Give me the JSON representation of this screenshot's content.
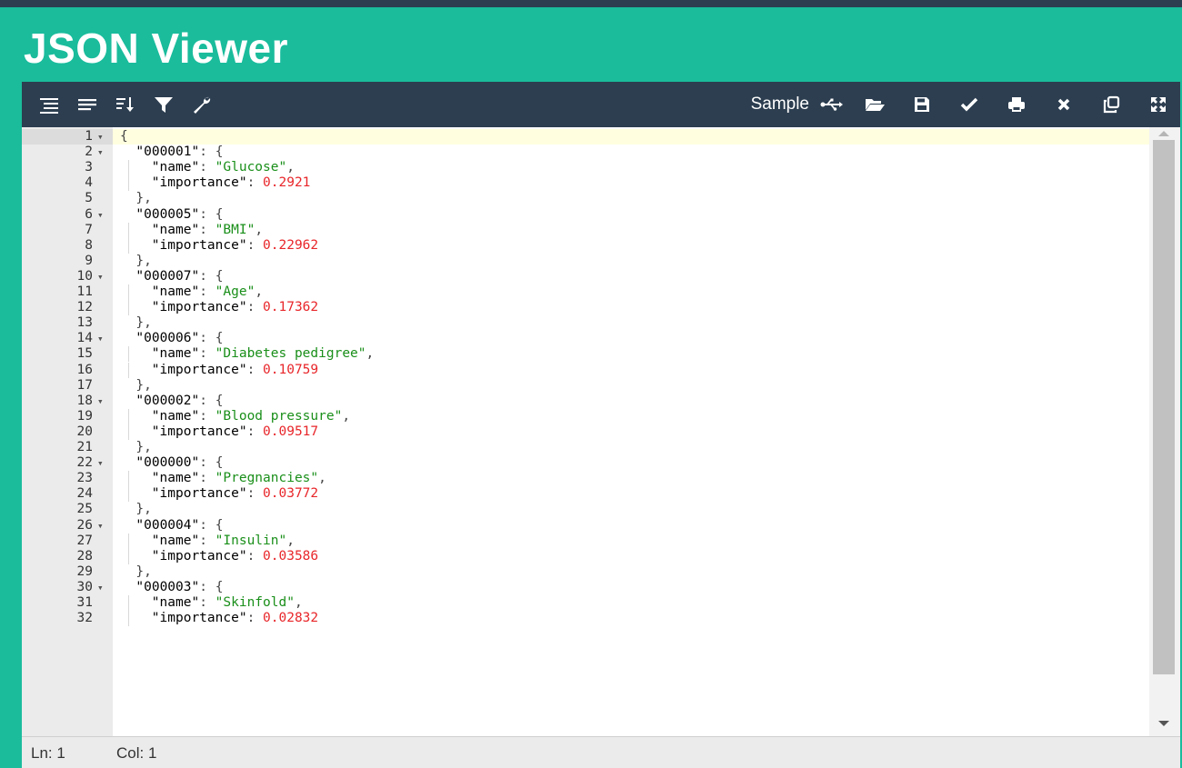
{
  "app": {
    "title": "JSON Viewer"
  },
  "toolbar": {
    "left_icons": [
      "format-icon",
      "compact-icon",
      "sort-icon",
      "filter-icon",
      "wrench-icon"
    ],
    "sample_label": "Sample",
    "right_icons": [
      "usb-icon",
      "open-folder-icon",
      "save-icon",
      "check-icon",
      "print-icon",
      "close-icon",
      "copy-icon",
      "expand-icon"
    ]
  },
  "editor": {
    "lines": [
      {
        "n": "1",
        "fold": true,
        "indent": 0,
        "tokens": [
          [
            "p",
            "{"
          ]
        ]
      },
      {
        "n": "2",
        "fold": true,
        "indent": 1,
        "tokens": [
          [
            "k",
            "\"000001\""
          ],
          [
            "p",
            ": {"
          ]
        ]
      },
      {
        "n": "3",
        "fold": false,
        "indent": 2,
        "tokens": [
          [
            "k",
            "\"name\""
          ],
          [
            "p",
            ": "
          ],
          [
            "s",
            "\"Glucose\""
          ],
          [
            "p",
            ","
          ]
        ]
      },
      {
        "n": "4",
        "fold": false,
        "indent": 2,
        "tokens": [
          [
            "k",
            "\"importance\""
          ],
          [
            "p",
            ": "
          ],
          [
            "n",
            "0.2921"
          ]
        ]
      },
      {
        "n": "5",
        "fold": false,
        "indent": 1,
        "tokens": [
          [
            "p",
            "},"
          ]
        ]
      },
      {
        "n": "6",
        "fold": true,
        "indent": 1,
        "tokens": [
          [
            "k",
            "\"000005\""
          ],
          [
            "p",
            ": {"
          ]
        ]
      },
      {
        "n": "7",
        "fold": false,
        "indent": 2,
        "tokens": [
          [
            "k",
            "\"name\""
          ],
          [
            "p",
            ": "
          ],
          [
            "s",
            "\"BMI\""
          ],
          [
            "p",
            ","
          ]
        ]
      },
      {
        "n": "8",
        "fold": false,
        "indent": 2,
        "tokens": [
          [
            "k",
            "\"importance\""
          ],
          [
            "p",
            ": "
          ],
          [
            "n",
            "0.22962"
          ]
        ]
      },
      {
        "n": "9",
        "fold": false,
        "indent": 1,
        "tokens": [
          [
            "p",
            "},"
          ]
        ]
      },
      {
        "n": "10",
        "fold": true,
        "indent": 1,
        "tokens": [
          [
            "k",
            "\"000007\""
          ],
          [
            "p",
            ": {"
          ]
        ]
      },
      {
        "n": "11",
        "fold": false,
        "indent": 2,
        "tokens": [
          [
            "k",
            "\"name\""
          ],
          [
            "p",
            ": "
          ],
          [
            "s",
            "\"Age\""
          ],
          [
            "p",
            ","
          ]
        ]
      },
      {
        "n": "12",
        "fold": false,
        "indent": 2,
        "tokens": [
          [
            "k",
            "\"importance\""
          ],
          [
            "p",
            ": "
          ],
          [
            "n",
            "0.17362"
          ]
        ]
      },
      {
        "n": "13",
        "fold": false,
        "indent": 1,
        "tokens": [
          [
            "p",
            "},"
          ]
        ]
      },
      {
        "n": "14",
        "fold": true,
        "indent": 1,
        "tokens": [
          [
            "k",
            "\"000006\""
          ],
          [
            "p",
            ": {"
          ]
        ]
      },
      {
        "n": "15",
        "fold": false,
        "indent": 2,
        "tokens": [
          [
            "k",
            "\"name\""
          ],
          [
            "p",
            ": "
          ],
          [
            "s",
            "\"Diabetes pedigree\""
          ],
          [
            "p",
            ","
          ]
        ]
      },
      {
        "n": "16",
        "fold": false,
        "indent": 2,
        "tokens": [
          [
            "k",
            "\"importance\""
          ],
          [
            "p",
            ": "
          ],
          [
            "n",
            "0.10759"
          ]
        ]
      },
      {
        "n": "17",
        "fold": false,
        "indent": 1,
        "tokens": [
          [
            "p",
            "},"
          ]
        ]
      },
      {
        "n": "18",
        "fold": true,
        "indent": 1,
        "tokens": [
          [
            "k",
            "\"000002\""
          ],
          [
            "p",
            ": {"
          ]
        ]
      },
      {
        "n": "19",
        "fold": false,
        "indent": 2,
        "tokens": [
          [
            "k",
            "\"name\""
          ],
          [
            "p",
            ": "
          ],
          [
            "s",
            "\"Blood pressure\""
          ],
          [
            "p",
            ","
          ]
        ]
      },
      {
        "n": "20",
        "fold": false,
        "indent": 2,
        "tokens": [
          [
            "k",
            "\"importance\""
          ],
          [
            "p",
            ": "
          ],
          [
            "n",
            "0.09517"
          ]
        ]
      },
      {
        "n": "21",
        "fold": false,
        "indent": 1,
        "tokens": [
          [
            "p",
            "},"
          ]
        ]
      },
      {
        "n": "22",
        "fold": true,
        "indent": 1,
        "tokens": [
          [
            "k",
            "\"000000\""
          ],
          [
            "p",
            ": {"
          ]
        ]
      },
      {
        "n": "23",
        "fold": false,
        "indent": 2,
        "tokens": [
          [
            "k",
            "\"name\""
          ],
          [
            "p",
            ": "
          ],
          [
            "s",
            "\"Pregnancies\""
          ],
          [
            "p",
            ","
          ]
        ]
      },
      {
        "n": "24",
        "fold": false,
        "indent": 2,
        "tokens": [
          [
            "k",
            "\"importance\""
          ],
          [
            "p",
            ": "
          ],
          [
            "n",
            "0.03772"
          ]
        ]
      },
      {
        "n": "25",
        "fold": false,
        "indent": 1,
        "tokens": [
          [
            "p",
            "},"
          ]
        ]
      },
      {
        "n": "26",
        "fold": true,
        "indent": 1,
        "tokens": [
          [
            "k",
            "\"000004\""
          ],
          [
            "p",
            ": {"
          ]
        ]
      },
      {
        "n": "27",
        "fold": false,
        "indent": 2,
        "tokens": [
          [
            "k",
            "\"name\""
          ],
          [
            "p",
            ": "
          ],
          [
            "s",
            "\"Insulin\""
          ],
          [
            "p",
            ","
          ]
        ]
      },
      {
        "n": "28",
        "fold": false,
        "indent": 2,
        "tokens": [
          [
            "k",
            "\"importance\""
          ],
          [
            "p",
            ": "
          ],
          [
            "n",
            "0.03586"
          ]
        ]
      },
      {
        "n": "29",
        "fold": false,
        "indent": 1,
        "tokens": [
          [
            "p",
            "},"
          ]
        ]
      },
      {
        "n": "30",
        "fold": true,
        "indent": 1,
        "tokens": [
          [
            "k",
            "\"000003\""
          ],
          [
            "p",
            ": {"
          ]
        ]
      },
      {
        "n": "31",
        "fold": false,
        "indent": 2,
        "tokens": [
          [
            "k",
            "\"name\""
          ],
          [
            "p",
            ": "
          ],
          [
            "s",
            "\"Skinfold\""
          ],
          [
            "p",
            ","
          ]
        ]
      },
      {
        "n": "32",
        "fold": false,
        "indent": 2,
        "tokens": [
          [
            "k",
            "\"importance\""
          ],
          [
            "p",
            ": "
          ],
          [
            "n",
            "0.02832"
          ]
        ]
      }
    ]
  },
  "status": {
    "line": "Ln: 1",
    "col": "Col: 1"
  },
  "colors": {
    "accent": "#1abc9c",
    "toolbar": "#2c3e50",
    "string": "#1a8f1a",
    "number": "#e8262a",
    "active_line": "#ffffe0"
  }
}
